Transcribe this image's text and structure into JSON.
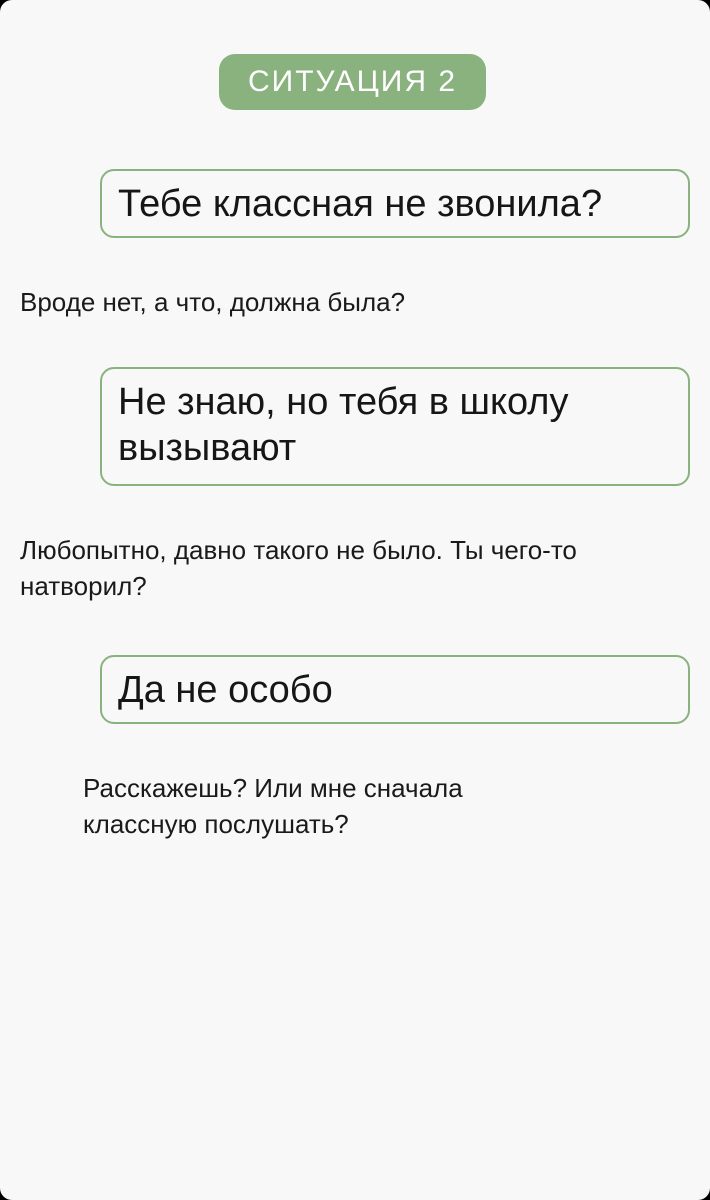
{
  "header": {
    "badge_label": "СИТУАЦИЯ 2"
  },
  "dialogue": {
    "bubble_1": "Тебе классная не звонила?",
    "reply_1": "Вроде нет, а что, должна была?",
    "bubble_2": "Не знаю, но тебя в школу вызывают",
    "reply_2": "Любопытно, давно такого не было. Ты чего-то натворил?",
    "bubble_3": "Да не особо",
    "reply_3": "Расскажешь? Или мне сначала классную послушать?"
  },
  "colors": {
    "accent": "#8ab27f",
    "background": "#f8f8f8",
    "text": "#1a1a1a"
  }
}
